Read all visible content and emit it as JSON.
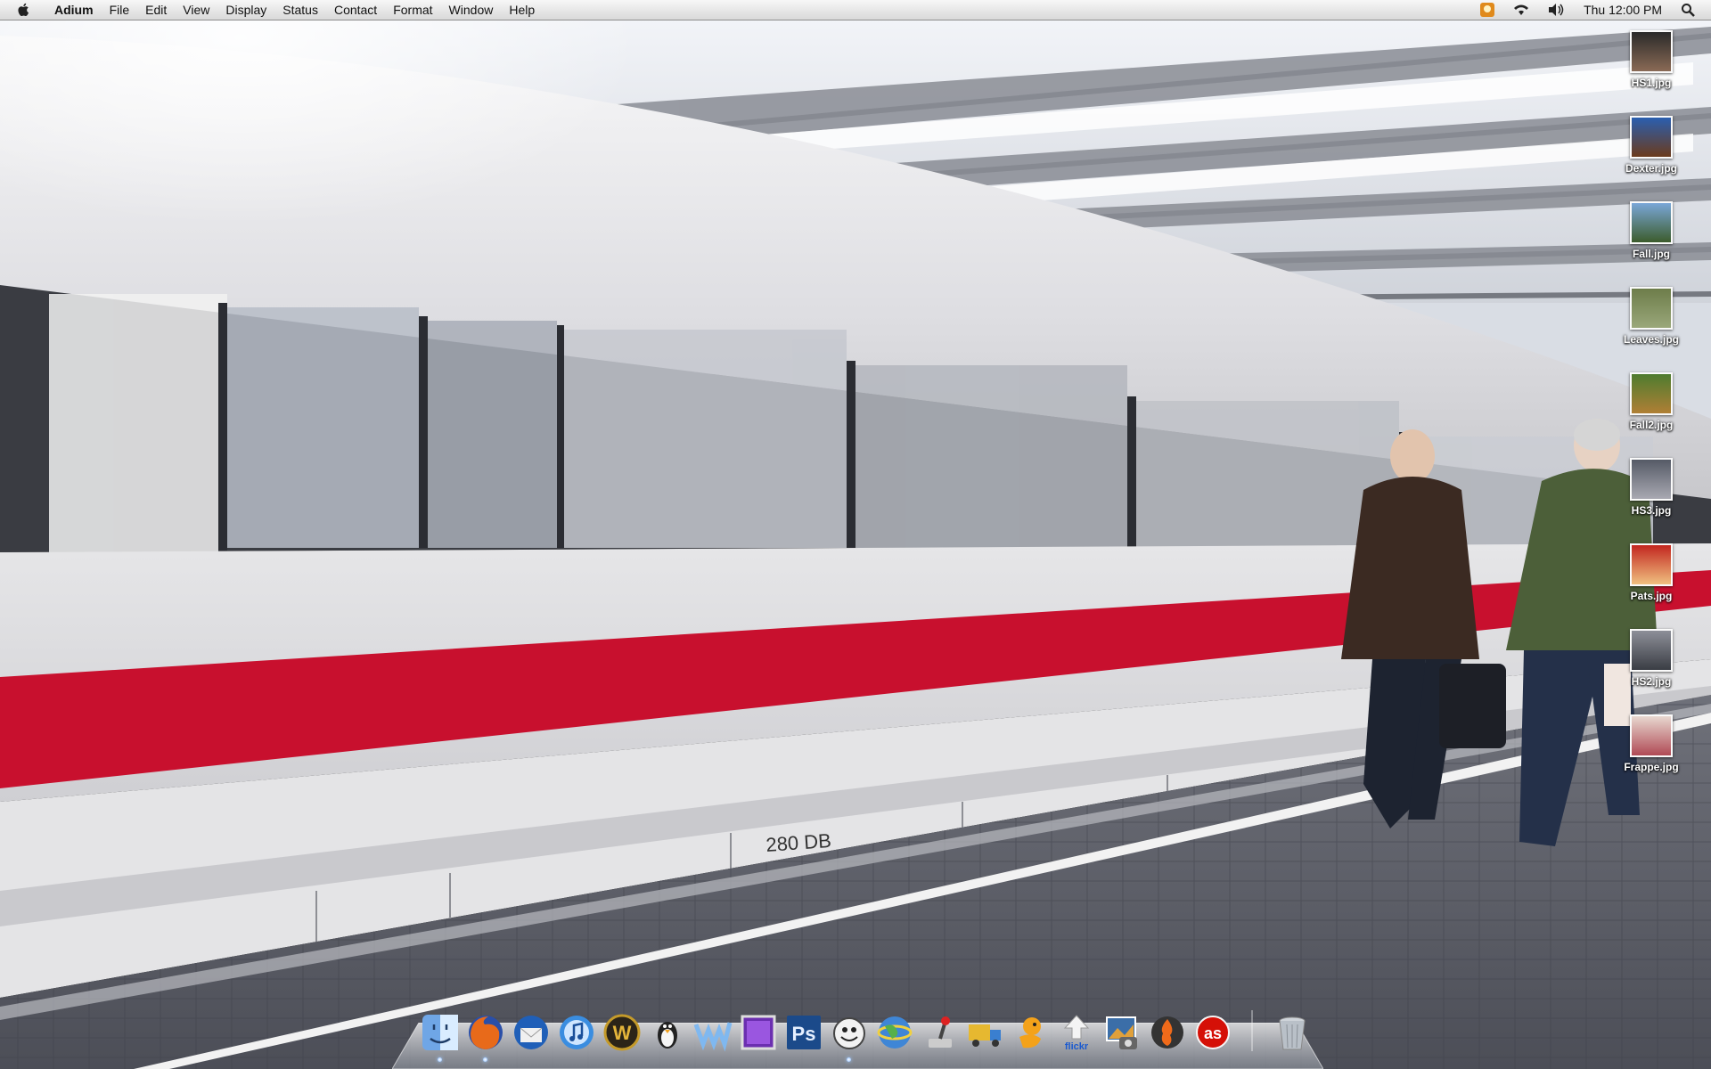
{
  "menubar": {
    "app_name": "Adium",
    "menus": [
      "File",
      "Edit",
      "View",
      "Display",
      "Status",
      "Contact",
      "Format",
      "Window",
      "Help"
    ],
    "clock": "Thu 12:00 PM",
    "extras": [
      "adium-status-icon",
      "wifi-icon",
      "volume-icon",
      "spotlight-icon"
    ]
  },
  "desktop": {
    "wallpaper": "photo of white high-speed train with red stripe at station platform",
    "icons": [
      {
        "label": "HS1.jpg",
        "icon": "image-file-icon"
      },
      {
        "label": "Dexter.jpg",
        "icon": "image-file-icon"
      },
      {
        "label": "Fall.jpg",
        "icon": "image-file-icon"
      },
      {
        "label": "Leaves.jpg",
        "icon": "image-file-icon"
      },
      {
        "label": "Fall2.jpg",
        "icon": "image-file-icon"
      },
      {
        "label": "HS3.jpg",
        "icon": "image-file-icon"
      },
      {
        "label": "Pats.jpg",
        "icon": "image-file-icon"
      },
      {
        "label": "HS2.jpg",
        "icon": "image-file-icon"
      },
      {
        "label": "Frappe.jpg",
        "icon": "image-file-icon"
      }
    ]
  },
  "dock": {
    "items": [
      {
        "icon": "finder-icon",
        "running": true
      },
      {
        "icon": "firefox-icon",
        "running": true
      },
      {
        "icon": "thunderbird-icon",
        "running": false
      },
      {
        "icon": "itunes-icon",
        "running": false
      },
      {
        "icon": "world-of-warcraft-icon",
        "running": false
      },
      {
        "icon": "penguin-icon",
        "running": false
      },
      {
        "icon": "writer-icon",
        "running": false
      },
      {
        "icon": "purple-app-icon",
        "running": false
      },
      {
        "icon": "photoshop-icon",
        "running": false
      },
      {
        "icon": "adium-duck-icon",
        "running": true
      },
      {
        "icon": "globe-icon",
        "running": false
      },
      {
        "icon": "joystick-icon",
        "running": false
      },
      {
        "icon": "transmit-truck-icon",
        "running": false
      },
      {
        "icon": "cyberduck-icon",
        "running": false
      },
      {
        "icon": "flickr-uploadr-icon",
        "running": false
      },
      {
        "icon": "iphoto-icon",
        "running": false
      },
      {
        "icon": "burn-icon",
        "running": false
      },
      {
        "icon": "lastfm-icon",
        "running": false
      },
      {
        "icon": "trash-icon",
        "running": false
      }
    ],
    "text": {
      "ps": "Ps",
      "flickr": "flickr",
      "lastfm": "as",
      "wow": "W"
    }
  }
}
